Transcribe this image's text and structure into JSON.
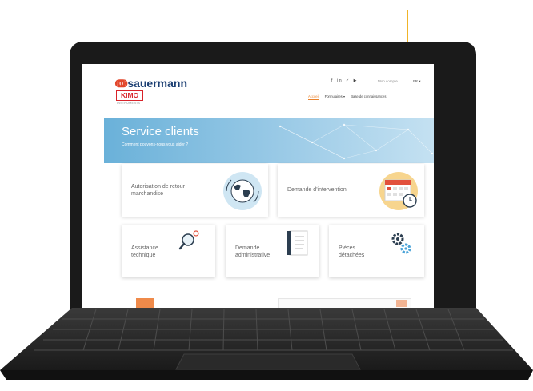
{
  "header": {
    "logo_text": "sauermann",
    "logo_symbol": "ↈ",
    "kimo_logo": "KIMO",
    "kimo_subtitle": "INSTRUMENTS",
    "social_icons": [
      "facebook-icon",
      "linkedin-icon",
      "twitter-icon",
      "youtube-icon"
    ],
    "social_display": "f in ✓ ▶",
    "account_label": "Mon compte",
    "language_label": "FR ▾"
  },
  "nav": {
    "items": [
      {
        "label": "Accueil",
        "active": true
      },
      {
        "label": "Formulaires ▾",
        "active": false
      },
      {
        "label": "Base de connaissances",
        "active": false
      }
    ]
  },
  "banner": {
    "title": "Service clients",
    "subtitle": "Comment pouvons-nous vous aider ?",
    "color": "#6ab1d9"
  },
  "cards": [
    {
      "line1": "Autorisation de retour",
      "line2": "marchandise",
      "icon": "globe-icon"
    },
    {
      "line1": "Demande d'intervention",
      "line2": "",
      "icon": "calendar-clock-icon"
    },
    {
      "line1": "Assistance",
      "line2": "technique",
      "icon": "magnifier-icon"
    },
    {
      "line1": "Demande",
      "line2": "administrative",
      "icon": "document-icon"
    },
    {
      "line1": "Pièces",
      "line2": "détachées",
      "icon": "gears-icon"
    }
  ],
  "colors": {
    "accent_orange": "#e9822c",
    "brand_blue": "#1c3f73",
    "kimo_red": "#d8232a"
  }
}
